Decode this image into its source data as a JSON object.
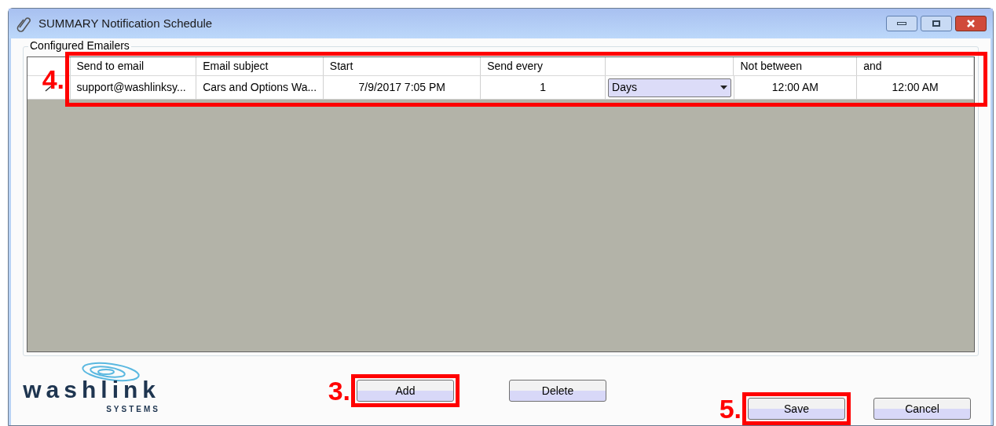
{
  "window": {
    "title": "SUMMARY Notification Schedule"
  },
  "group": {
    "label": "Configured Emailers"
  },
  "table": {
    "annotation": "4.",
    "columns": [
      "Send to email",
      "Email subject",
      "Start",
      "Send every",
      "",
      "Not between",
      "and"
    ],
    "rows": [
      {
        "editing": true,
        "email": "support@washlinksy...",
        "subject": "Cars and Options Wa...",
        "start": "7/9/2017 7:05 PM",
        "send_every": "1",
        "unit": "Days",
        "not_between": "12:00 AM",
        "and": "12:00 AM"
      }
    ]
  },
  "logo": {
    "name": "washlink",
    "tagline": "SYSTEMS"
  },
  "buttons": [
    {
      "label": "Add",
      "kind": "add",
      "annotation": "3."
    },
    {
      "label": "Delete",
      "kind": "delete"
    },
    {
      "label": "Save",
      "kind": "save",
      "annotation": "5."
    },
    {
      "label": "Cancel",
      "kind": "cancel"
    }
  ]
}
